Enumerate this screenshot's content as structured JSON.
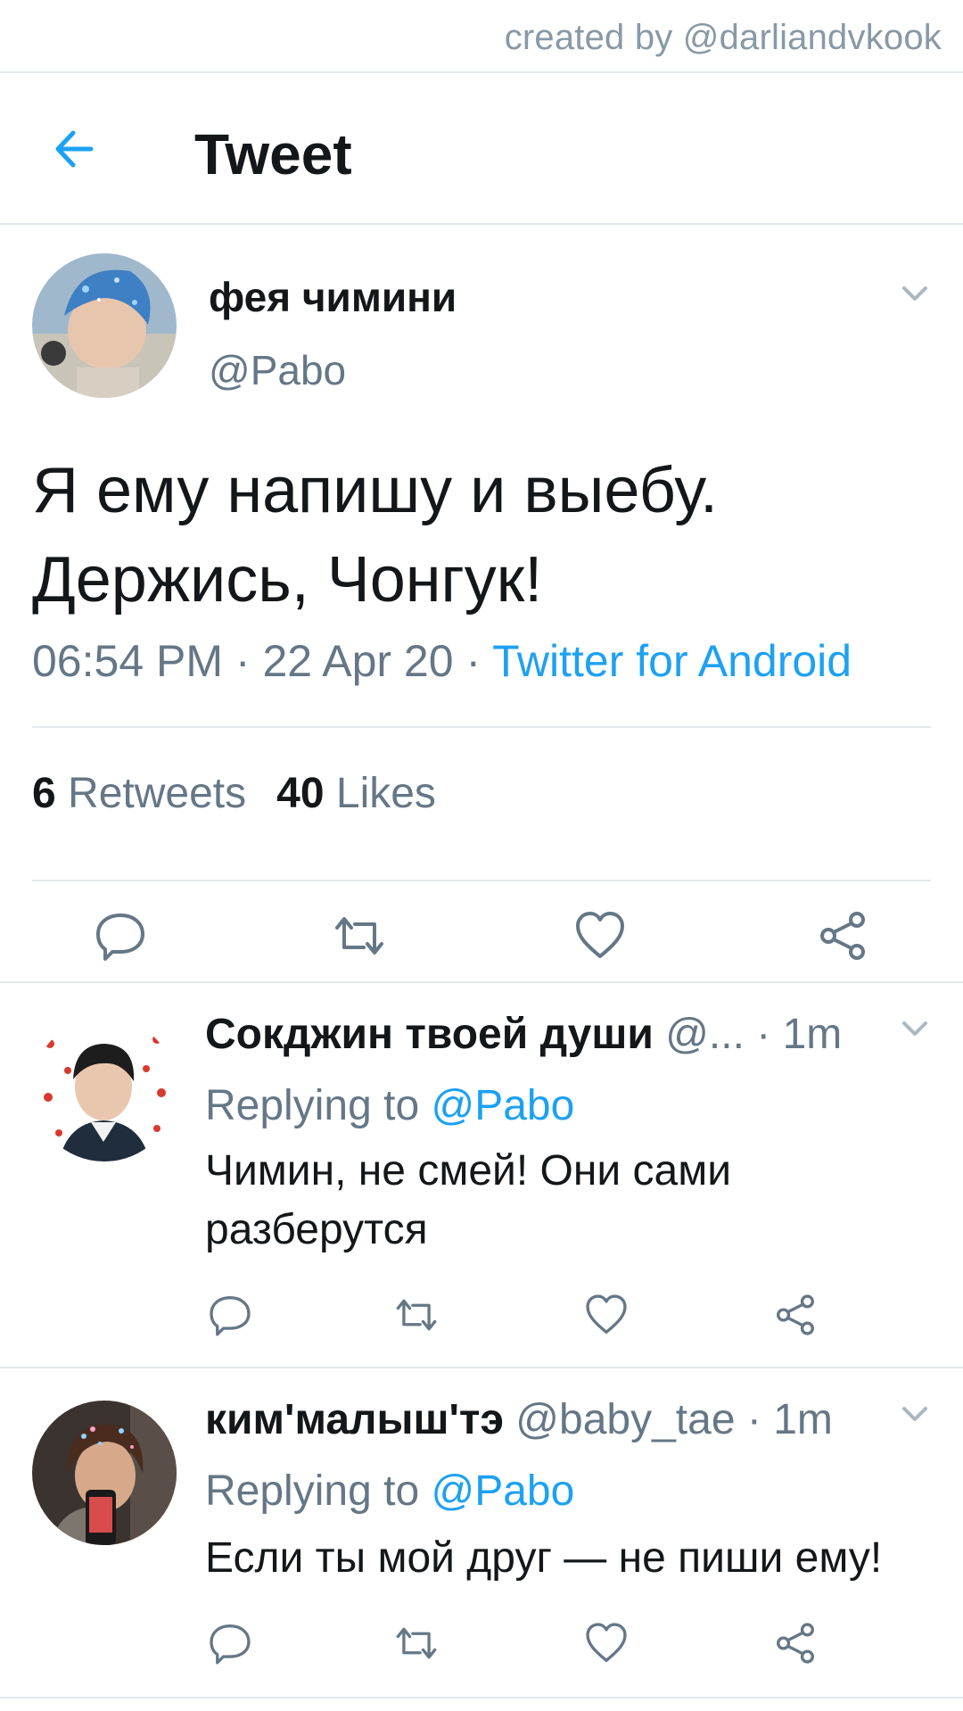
{
  "credit": "created by @darliandvkook",
  "header": {
    "title": "Tweet",
    "back_icon": "arrow-left-icon",
    "accent": "#1da1f2"
  },
  "tweet": {
    "name": "фея чимини",
    "handle": "@Pabo",
    "text_line1": "Я ему напишу и выебу.",
    "text_line2": "Держись, Чонгук!",
    "time": "06:54 PM",
    "sep": "·",
    "date": "22 Apr 20",
    "source": "Twitter for Android",
    "retweets_count": "6",
    "retweets_label": "Retweets",
    "likes_count": "40",
    "likes_label": "Likes"
  },
  "replies": [
    {
      "name": "Сокджин твоей души",
      "handle": "@...",
      "time": "· 1m",
      "replying_prefix": "Replying to",
      "replying_to": "@Pabo",
      "text_line1": "Чимин, не смей! Они сами",
      "text_line2": "разберутся"
    },
    {
      "name": "ким'малыш'тэ",
      "handle": "@baby_tae",
      "time": "· 1m",
      "replying_prefix": "Replying to",
      "replying_to": "@Pabo",
      "text_line1": "Если ты мой друг — не пиши ему!"
    }
  ],
  "colors": {
    "text": "#14171a",
    "secondary": "#657786",
    "link": "#1da1f2",
    "border": "#e1e8ed"
  }
}
